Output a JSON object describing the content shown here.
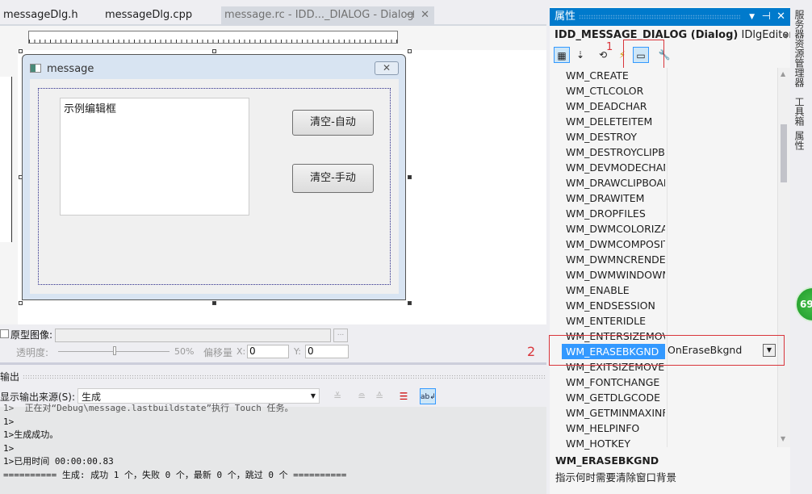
{
  "tabs": [
    {
      "label": "messageDlg.h"
    },
    {
      "label": "messageDlg.cpp"
    },
    {
      "label": "message.rc - IDD..._DIALOG - Dialog"
    }
  ],
  "dialog": {
    "title": "message",
    "edit_text": "示例编辑框",
    "btn_auto": "清空-自动",
    "btn_manual": "清空-手动"
  },
  "proto": {
    "checkbox_label": "原型图像:",
    "transparency_label": "透明度:",
    "transparency_value": "50%",
    "transparency_fraction": 0.5,
    "offset_label": "偏移量",
    "x_label": "X:",
    "x_value": "0",
    "y_label": "Y:",
    "y_value": "0",
    "browse": "..."
  },
  "output": {
    "title": "输出",
    "source_label": "显示输出来源(S):",
    "source_value": "生成",
    "lines": [
      "1>  正在对“Debug\\message.lastbuildstate”执行 Touch 任务。",
      "1>",
      "1>生成成功。",
      "1>",
      "1>已用时间 00:00:00.83",
      "========== 生成: 成功 1 个，失败 0 个，最新 0 个，跳过 0 个 =========="
    ]
  },
  "properties": {
    "title": "属性",
    "object": "IDD_MESSAGE_DIALOG (Dialog)",
    "editor": "IDlgEditor",
    "items": [
      "WM_CREATE",
      "WM_CTLCOLOR",
      "WM_DEADCHAR",
      "WM_DELETEITEM",
      "WM_DESTROY",
      "WM_DESTROYCLIPBC",
      "WM_DEVMODECHAN",
      "WM_DRAWCLIPBOAR",
      "WM_DRAWITEM",
      "WM_DROPFILES",
      "WM_DWMCOLORIZAT",
      "WM_DWMCOMPOSIT",
      "WM_DWMNCRENDEI",
      "WM_DWMWINDOWM",
      "WM_ENABLE",
      "WM_ENDSESSION",
      "WM_ENTERIDLE",
      "WM_ENTERSIZEMOV",
      "WM_ERASEBKGND",
      "WM_EXITSIZEMOVE",
      "WM_FONTCHANGE",
      "WM_GETDLGCODE",
      "WM_GETMINMAXINF",
      "WM_HELPINFO",
      "WM_HOTKEY"
    ],
    "selected_value": "OnEraseBkgnd",
    "desc_title": "WM_ERASEBKGND",
    "desc_text": "指示何时需要清除窗口背景"
  },
  "annotations": {
    "one": "1",
    "two": "2"
  },
  "side_tabs": [
    "服务器资源管理器",
    "工具箱",
    "属性"
  ],
  "badge": "69",
  "colors": {
    "accent": "#007acc",
    "selection": "#3399ff",
    "annotation": "#d9353b"
  }
}
